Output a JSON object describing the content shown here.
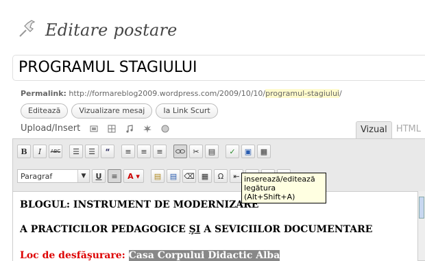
{
  "heading": {
    "title": "Editare postare",
    "icon": "pushpin-icon"
  },
  "post_title": {
    "value": "PROGRAMUL STAGIULUI"
  },
  "permalink": {
    "label": "Permalink:",
    "url_base": "http://formareblog2009.wordpress.com/2009/10/10/",
    "slug": "programul-stagiului",
    "url_end": "/"
  },
  "permalink_buttons": {
    "edit": "Editează",
    "view": "Vizualizare mesaj",
    "shortlink": "Ia Link Scurt"
  },
  "upload": {
    "label": "Upload/Insert"
  },
  "editor_tabs": {
    "visual": "Vizual",
    "html": "HTML"
  },
  "toolbar": {
    "format_select": "Paragraf"
  },
  "tooltip": {
    "text": "inserează/editează legătura (Alt+Shift+A)"
  },
  "content": {
    "line1": "BLOGUL: INSTRUMENT DE MODERNIZARE",
    "line2_a": "A PRACTICILOR PEDAGOGICE ",
    "line2_si": "ŞI",
    "line2_b": " A SEVICIILOR DOCUMENTARE",
    "line3_label": "Loc de desfăşurare:",
    "line3_value": "Casa Corpului Didactic Alba"
  },
  "colors": {
    "accent_highlight": "#fffbcc",
    "toolbar_bg": "#e9e9e9",
    "red_text": "#dd0000",
    "selection": "#888888"
  }
}
